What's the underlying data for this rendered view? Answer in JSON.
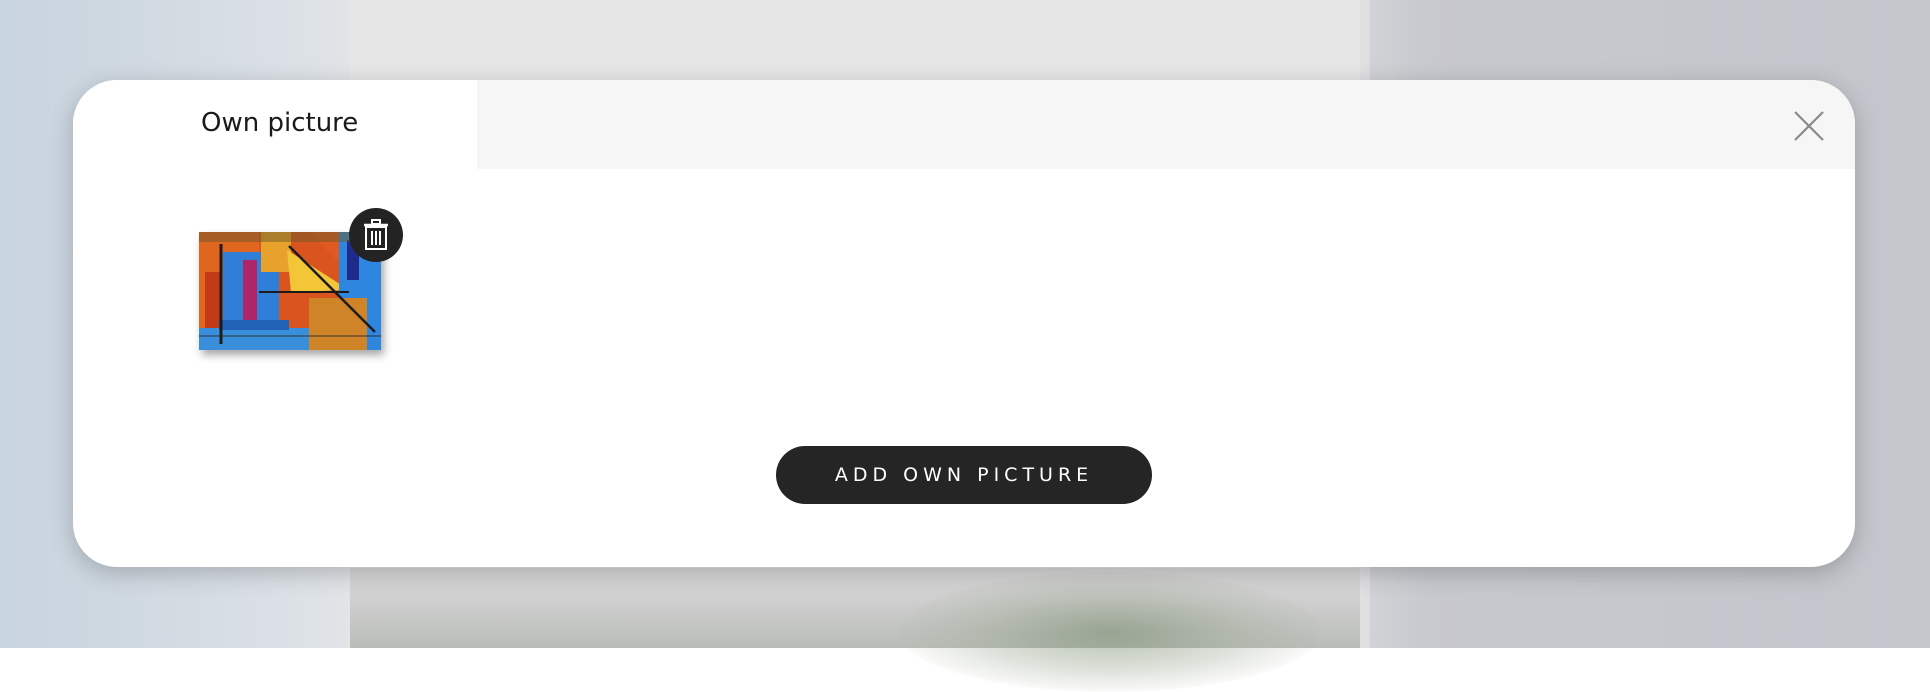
{
  "modal": {
    "tabs": [
      {
        "label": "Own picture",
        "active": true
      }
    ],
    "close_icon": "close-icon",
    "pictures": [
      {
        "kind": "abstract-painting-thumbnail",
        "delete_icon": "trash-icon"
      }
    ],
    "add_button_label": "ADD OWN PICTURE"
  },
  "colors": {
    "button_bg": "#252525",
    "tab_bar_bg": "#f6f6f6",
    "modal_bg": "#ffffff"
  }
}
